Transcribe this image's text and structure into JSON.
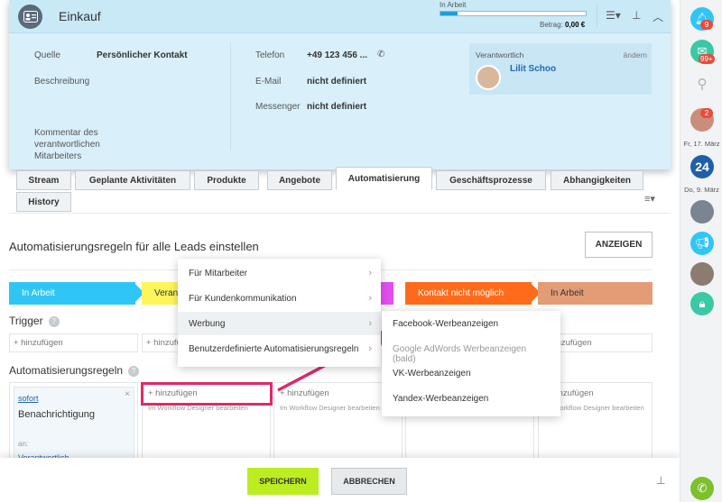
{
  "header": {
    "title": "Einkauf",
    "stage_label": "In Arbeit",
    "stage_progress": 0.12,
    "amount_label": "Betrag:",
    "amount_value": "0,00 €",
    "fields": {
      "source_label": "Quelle",
      "source_value": "Persönlicher Kontakt",
      "description_label": "Beschreibung",
      "phone_label": "Telefon",
      "phone_value": "+49 123 456 ...",
      "email_label": "E-Mail",
      "email_value": "nicht definiert",
      "messenger_label": "Messenger",
      "messenger_value": "nicht definiert",
      "comment_label": "Kommentar des verantwortlichen Mitarbeiters"
    },
    "responsible": {
      "label": "Verantwortlich",
      "change_label": "ändern",
      "name": "Lilit Schoo"
    }
  },
  "tabs": [
    "Stream",
    "Geplante Aktivitäten",
    "Produkte",
    "Angebote",
    "Automatisierung",
    "Geschäftsprozesse",
    "Abhangigkeiten",
    "History"
  ],
  "automation": {
    "title": "Automatisierungsregeln für alle Leads einstellen",
    "show_button": "ANZEIGEN",
    "stages": [
      {
        "label": "In Arbeit",
        "color": "#2fc6f6"
      },
      {
        "label": "Veran",
        "color": "#fff55a"
      },
      {
        "label": "Kontakt nicht möglich",
        "color": "#ff5752"
      },
      {
        "label": "In Arbeit",
        "color": "#e39c76"
      }
    ],
    "trigger_label": "Trigger",
    "add_label": "+ hinzufügen",
    "rules_label": "Automatisierungsregeln",
    "rule_card": {
      "timing": "sofort",
      "name": "Benachrichtigung",
      "to_label": "an:",
      "to_value": "Verantwortlich"
    },
    "workflow_note": "Im Workflow Designer bearbeiten"
  },
  "menu": {
    "items": [
      "Für Mitarbeiter",
      "Für Kundenkommunikation",
      "Werbung",
      "Benutzerdefinierte Automatisierungsregeln"
    ],
    "submenu": [
      "Facebook-Werbeanzeigen",
      "Google AdWords Werbeanzeigen (bald)",
      "VK-Werbeanzeigen",
      "Yandex-Werbeanzeigen"
    ]
  },
  "footer": {
    "save": "SPEICHERN",
    "cancel": "ABBRECHEN"
  },
  "sidebar": {
    "notif_badge": "9",
    "chat_badge": "99+",
    "avatar_badge": "2",
    "date1": "Fr, 17. März",
    "calendar_day": "24",
    "date2": "Do, 9. März"
  },
  "colors": {
    "accent_blue": "#1c9fd8",
    "highlight_pink": "#e0286c",
    "save_green": "#bbed21"
  }
}
